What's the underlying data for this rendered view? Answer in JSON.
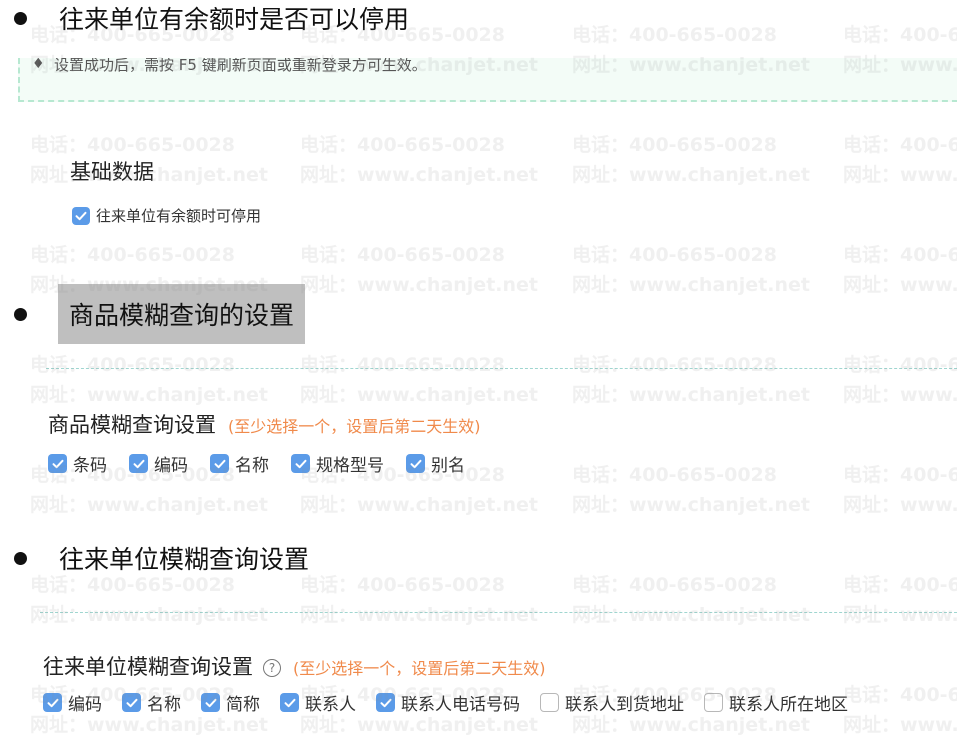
{
  "colors": {
    "checkbox_checked": "#5b9be8",
    "note": "#f08a4b",
    "highlight": "#bfbfbf",
    "tip_border": "#b7e8d1"
  },
  "watermark": {
    "phone": "电话：400-665-0028",
    "site": "网址：www.chanjet.net"
  },
  "section1": {
    "heading": "往来单位有余额时是否可以停用",
    "tip_icon": "lightbulb-icon",
    "tip_text": "设置成功后，需按 F5 键刷新页面或重新登录方可生效。",
    "group_title": "基础数据",
    "checkbox": {
      "label": "往来单位有余额时可停用",
      "checked": true
    }
  },
  "section2": {
    "heading": "商品模糊查询的设置",
    "title": "商品模糊查询设置",
    "note": "(至少选择一个，设置后第二天生效)",
    "options": [
      {
        "label": "条码",
        "checked": true
      },
      {
        "label": "编码",
        "checked": true
      },
      {
        "label": "名称",
        "checked": true
      },
      {
        "label": "规格型号",
        "checked": true
      },
      {
        "label": "别名",
        "checked": true
      }
    ]
  },
  "section3": {
    "heading": "往来单位模糊查询设置",
    "title": "往来单位模糊查询设置",
    "help_icon": "question-circle-icon",
    "help_glyph": "?",
    "note": "(至少选择一个，设置后第二天生效)",
    "options": [
      {
        "label": "编码",
        "checked": true
      },
      {
        "label": "名称",
        "checked": true
      },
      {
        "label": "简称",
        "checked": true
      },
      {
        "label": "联系人",
        "checked": true
      },
      {
        "label": "联系人电话号码",
        "checked": true
      },
      {
        "label": "联系人到货地址",
        "checked": false
      },
      {
        "label": "联系人所在地区",
        "checked": false
      }
    ]
  }
}
